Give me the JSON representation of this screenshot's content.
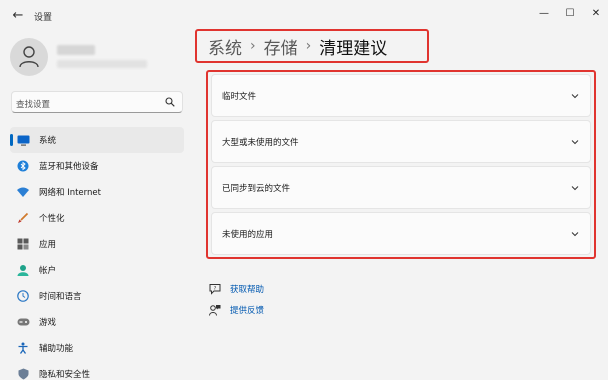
{
  "window": {
    "title": "设置",
    "back_glyph": "←",
    "minimize_glyph": "—",
    "maximize_glyph": "☐",
    "close_glyph": "✕"
  },
  "search": {
    "placeholder": "查找设置"
  },
  "sidebar": {
    "items": [
      {
        "label": "系统",
        "icon": "monitor-icon",
        "active": true
      },
      {
        "label": "蓝牙和其他设备",
        "icon": "bluetooth-icon"
      },
      {
        "label": "网络和 Internet",
        "icon": "wifi-icon"
      },
      {
        "label": "个性化",
        "icon": "brush-icon"
      },
      {
        "label": "应用",
        "icon": "apps-icon"
      },
      {
        "label": "帐户",
        "icon": "account-icon"
      },
      {
        "label": "时间和语言",
        "icon": "globe-clock-icon"
      },
      {
        "label": "游戏",
        "icon": "gamepad-icon"
      },
      {
        "label": "辅助功能",
        "icon": "accessibility-icon"
      },
      {
        "label": "隐私和安全性",
        "icon": "shield-icon"
      }
    ]
  },
  "breadcrumb": {
    "parts": [
      "系统",
      "存储"
    ],
    "separator": "›",
    "current": "清理建议"
  },
  "main": {
    "cards": [
      {
        "label": "临时文件"
      },
      {
        "label": "大型或未使用的文件"
      },
      {
        "label": "已同步到云的文件"
      },
      {
        "label": "未使用的应用"
      }
    ]
  },
  "help": {
    "get_help": "获取帮助",
    "feedback": "提供反馈"
  },
  "colors": {
    "accent": "#0067c0",
    "highlight": "#e0342f",
    "link": "#0058b0"
  }
}
